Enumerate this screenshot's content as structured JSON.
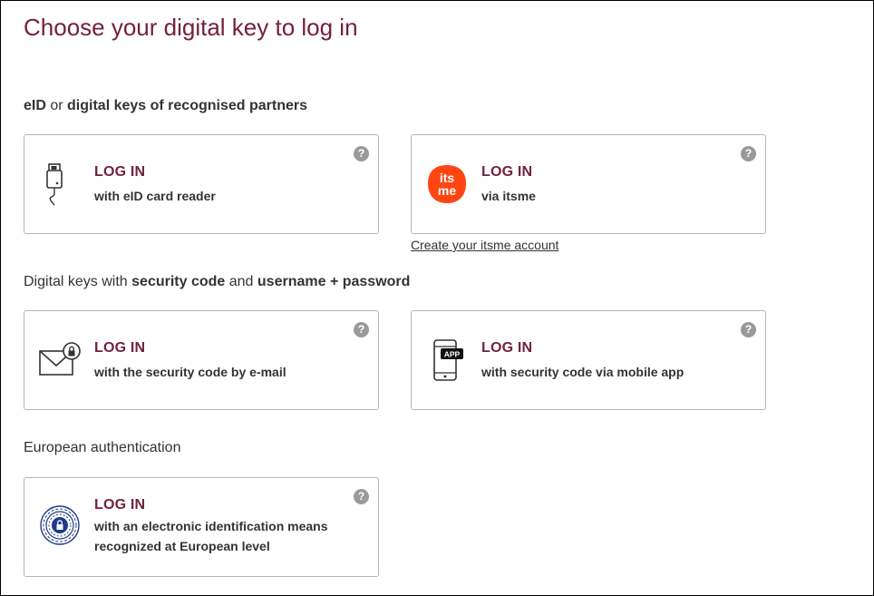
{
  "page_title": "Choose your digital key to log in",
  "sections": [
    {
      "heading_parts": [
        {
          "text": "eID",
          "bold": true
        },
        {
          "text": " or ",
          "bold": false
        },
        {
          "text": "digital keys of recognised partners",
          "bold": true
        }
      ]
    },
    {
      "heading_parts": [
        {
          "text": "Digital keys with ",
          "bold": false
        },
        {
          "text": "security code",
          "bold": true
        },
        {
          "text": " and ",
          "bold": false
        },
        {
          "text": "username + password",
          "bold": true
        }
      ]
    },
    {
      "heading_parts": [
        {
          "text": "European authentication",
          "bold": false
        }
      ]
    }
  ],
  "cards": {
    "eid": {
      "title": "LOG IN",
      "subtitle": "with eID card reader",
      "icon": "eid-card-reader-icon",
      "help": "?"
    },
    "itsme": {
      "title": "LOG IN",
      "subtitle": "via itsme",
      "icon": "itsme-logo-icon",
      "help": "?",
      "logo_line1": "its",
      "logo_line2": "me",
      "logo_color": "#ff4612"
    },
    "email": {
      "title": "LOG IN",
      "subtitle": "with the security code by e-mail",
      "icon": "email-lock-icon",
      "help": "?"
    },
    "mobile_app": {
      "title": "LOG IN",
      "subtitle": "with security code via mobile app",
      "icon": "mobile-app-icon",
      "help": "?",
      "badge": "APP"
    },
    "european": {
      "title": "LOG IN",
      "subtitle": "with an electronic identification means recognized at European level",
      "icon": "european-eid-icon",
      "help": "?"
    }
  },
  "itsme_create_link": "Create your itsme account",
  "colors": {
    "accent": "#75203f",
    "text": "#333333",
    "border": "#b5b5b5",
    "help_icon": "#9a9a9a",
    "eu_blue": "#1f3a8a"
  }
}
